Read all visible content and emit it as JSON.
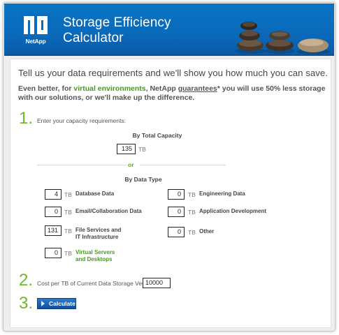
{
  "header": {
    "logo_text": "NetApp",
    "title_line1": "Storage Efficiency",
    "title_line2": "Calculator"
  },
  "intro": "Tell us your data requirements and we'll show you how much you can save.",
  "subintro": {
    "part1": "Even better, for ",
    "green": "virtual environments",
    "part2": ", NetApp ",
    "underlined": "guarantees",
    "part3": "* you will use 50% less storage with our solutions, or we'll make up the difference."
  },
  "step1": {
    "number": "1.",
    "label": "Enter your capacity requirements:",
    "total_heading": "By Total Capacity",
    "total_value": "135",
    "unit": "TB",
    "or": "or",
    "type_heading": "By Data Type",
    "types": [
      {
        "value": "4",
        "unit": "TB",
        "label": "Database Data"
      },
      {
        "value": "0",
        "unit": "TB",
        "label": "Email/Collaboration Data"
      },
      {
        "value": "131",
        "unit": "TB",
        "label_line1": "File Services and",
        "label_line2": "IT Infrastructure"
      },
      {
        "value": "0",
        "unit": "TB",
        "label_line1": "Virtual Servers",
        "label_line2": "and Desktops"
      },
      {
        "value": "0",
        "unit": "TB",
        "label": "Engineering Data"
      },
      {
        "value": "0",
        "unit": "TB",
        "label": "Application Development"
      },
      {
        "value": "0",
        "unit": "TB",
        "label": "Other"
      }
    ]
  },
  "step2": {
    "number": "2.",
    "label": "Cost per TB of Current Data Storage Vendor: $",
    "value": "10000"
  },
  "step3": {
    "number": "3.",
    "button": "Calculate"
  },
  "colors": {
    "header_blue": "#0a6abb",
    "accent_green": "#72b62d",
    "button_blue": "#0e4f9e"
  }
}
